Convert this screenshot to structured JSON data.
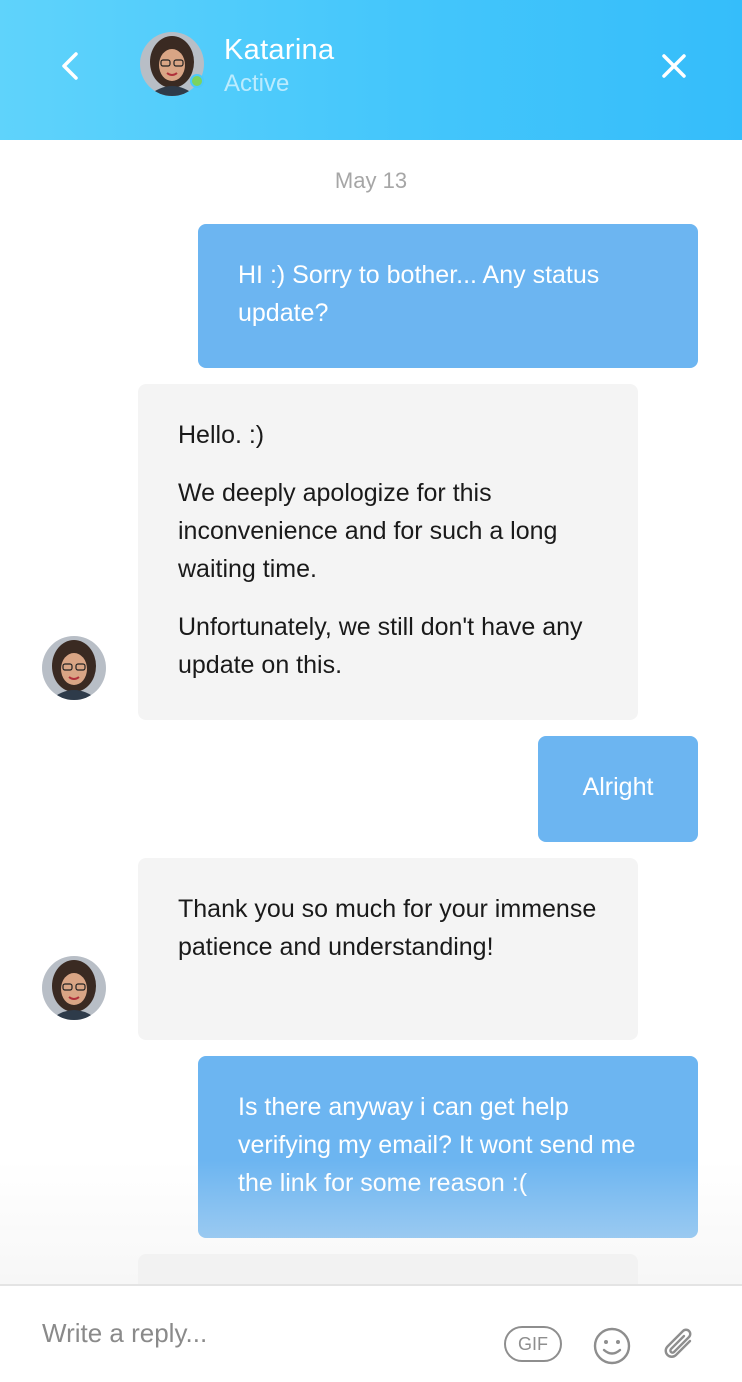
{
  "header": {
    "back_icon": "chevron-left-icon",
    "agent_name": "Katarina",
    "agent_status": "Active",
    "online_color": "#7cd35d",
    "close_icon": "close-icon",
    "gradient": [
      "#5fd3fb",
      "#35bdfa"
    ]
  },
  "thread": {
    "date_label": "May 13",
    "messages": [
      {
        "sender": "user",
        "paragraphs": [
          "HI :) Sorry to bother... Any status update?"
        ]
      },
      {
        "sender": "agent",
        "paragraphs": [
          "Hello. :)",
          "We deeply apologize for this inconvenience and for such a long waiting time.",
          "Unfortunately, we still don't have any update on this."
        ]
      },
      {
        "sender": "user",
        "paragraphs": [
          "Alright"
        ]
      },
      {
        "sender": "agent",
        "paragraphs": [
          "Thank you so much for your immense patience and understanding!"
        ]
      },
      {
        "sender": "user",
        "paragraphs": [
          "Is there anyway i can get help verifying my email? It wont send me the link for some reason :("
        ]
      }
    ],
    "user_bubble_color": "#6cb5f1",
    "agent_bubble_color": "#f4f4f4"
  },
  "composer": {
    "placeholder": "Write a reply...",
    "gif_label": "GIF",
    "emoji_icon": "smiley-icon",
    "attach_icon": "paperclip-icon"
  }
}
